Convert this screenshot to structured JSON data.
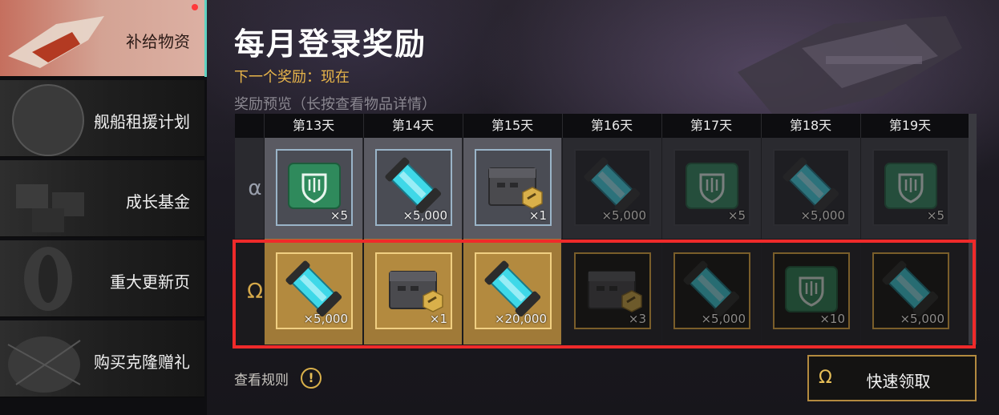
{
  "sidebar": {
    "items": [
      {
        "label": "补给物资"
      },
      {
        "label": "舰船租援计划"
      },
      {
        "label": "成长基金"
      },
      {
        "label": "重大更新页"
      },
      {
        "label": "购买克隆赠礼"
      }
    ]
  },
  "header": {
    "title": "每月登录奖励",
    "subtitle": "下一个奖励：现在",
    "preview_label": "奖励预览（长按查看物品详情）"
  },
  "rewards": {
    "days": [
      "第13天",
      "第14天",
      "第15天",
      "第16天",
      "第17天",
      "第18天",
      "第19天"
    ],
    "alpha_tier": "α",
    "omega_tier": "Ω",
    "alpha": [
      {
        "icon": "skill-card-icon",
        "qty": "×5"
      },
      {
        "icon": "energy-canister-icon",
        "qty": "×5,000"
      },
      {
        "icon": "supply-crate-icon",
        "qty": "×1"
      },
      {
        "icon": "energy-canister-icon",
        "qty": "×5,000"
      },
      {
        "icon": "skill-card-icon",
        "qty": "×5"
      },
      {
        "icon": "energy-canister-icon",
        "qty": "×5,000"
      },
      {
        "icon": "skill-card-icon",
        "qty": "×5"
      }
    ],
    "omega": [
      {
        "icon": "energy-canister-icon",
        "qty": "×5,000"
      },
      {
        "icon": "supply-crate-icon",
        "qty": "×1"
      },
      {
        "icon": "energy-canister-icon",
        "qty": "×20,000"
      },
      {
        "icon": "supply-crate-icon",
        "qty": "×3"
      },
      {
        "icon": "energy-canister-icon",
        "qty": "×5,000"
      },
      {
        "icon": "skill-card-icon",
        "qty": "×10"
      },
      {
        "icon": "energy-canister-icon",
        "qty": "×5,000"
      }
    ]
  },
  "footer": {
    "rules_label": "查看规则",
    "rules_icon": "!",
    "claim_icon": "Ω",
    "claim_label": "快速领取"
  },
  "colors": {
    "accent_gold": "#d6a94a",
    "highlight_red": "#ef2a2a",
    "canister_cyan": "#3fd8e8",
    "card_green": "#2f8a5c",
    "active_tab": "#d4a394"
  }
}
